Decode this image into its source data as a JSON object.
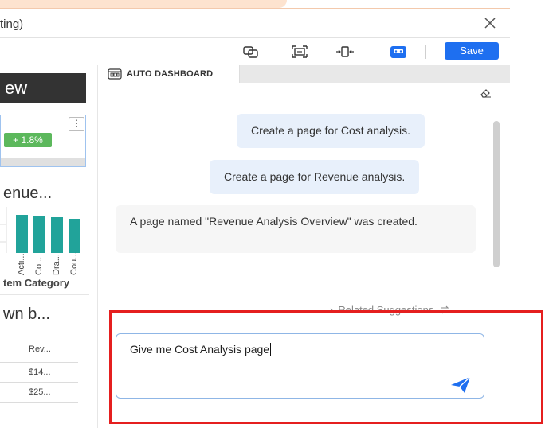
{
  "window": {
    "title": "ting)",
    "close_icon": "close-icon"
  },
  "toolbar": {
    "icons": [
      "copy-layout-icon",
      "fit-screen-icon",
      "resize-width-icon",
      "robot-assistant-icon"
    ],
    "save_label": "Save",
    "accent": "#1e6ff0"
  },
  "canvas": {
    "banner": "ew",
    "kpi_badge": "+ 1.8%",
    "kpi_menu": "⋮",
    "widget2_title": "enue...",
    "chart_labels": [
      "Acti...",
      "Co...",
      "Dra...",
      "Cou..."
    ],
    "chart_xlabel": "tem Category",
    "widget3_title": "wn b...",
    "table_header": "Rev...",
    "table_cells": [
      "$14...",
      "$25..."
    ]
  },
  "panel": {
    "tab_label": "AUTO DASHBOARD",
    "messages": [
      {
        "role": "user",
        "text": "Create a page for Cost analysis."
      },
      {
        "role": "user",
        "text": "Create a page for Revenue analysis."
      },
      {
        "role": "bot",
        "text": "A page named \"Revenue Analysis Overview\" was created."
      }
    ],
    "related_label": "Related Suggestions",
    "input_value": "Give me Cost Analysis page",
    "highlight_color": "#e51f1f"
  }
}
